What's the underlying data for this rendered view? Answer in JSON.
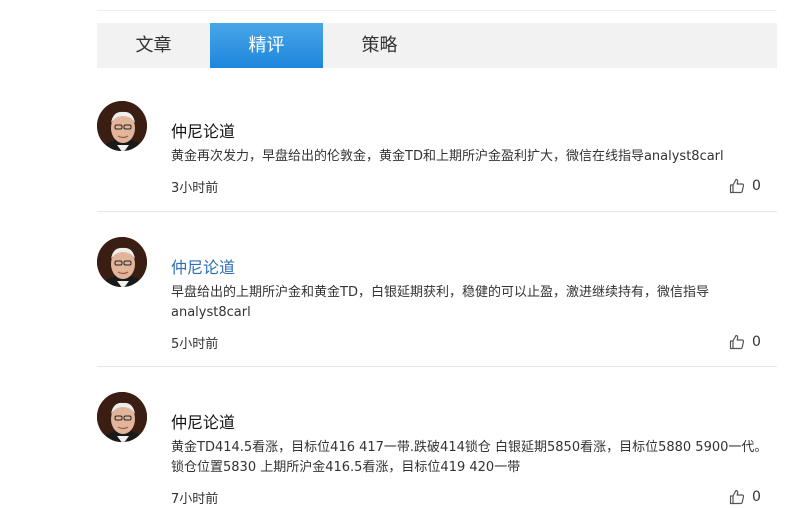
{
  "tabs": [
    {
      "label": "文章",
      "active": false
    },
    {
      "label": "精评",
      "active": true
    },
    {
      "label": "策略",
      "active": false
    }
  ],
  "posts": [
    {
      "author": "仲尼论道",
      "content": "黄金再次发力，早盘给出的伦敦金，黄金TD和上期所沪金盈利扩大，微信在线指导analyst8carl",
      "time": "3小时前",
      "likes": "0"
    },
    {
      "author": "仲尼论道",
      "content": "早盘给出的上期所沪金和黄金TD，白银延期获利，稳健的可以止盈，激进继续持有，微信指导analyst8carl",
      "time": "5小时前",
      "likes": "0"
    },
    {
      "author": "仲尼论道",
      "content": "黄金TD414.5看涨，目标位416 417一带.跌破414锁仓 白银延期5850看涨，目标位5880 5900一代。锁仓位置5830 上期所沪金416.5看涨，目标位419 420一带",
      "time": "7小时前",
      "likes": "0"
    }
  ],
  "colors": {
    "tab_bar_bg": "#f2f2f2",
    "tab_active_bg": "#1d86dc",
    "author_link": "#2e6fb7"
  },
  "icons": {
    "avatar": "author-avatar-portrait",
    "like": "thumbs-up-icon"
  }
}
